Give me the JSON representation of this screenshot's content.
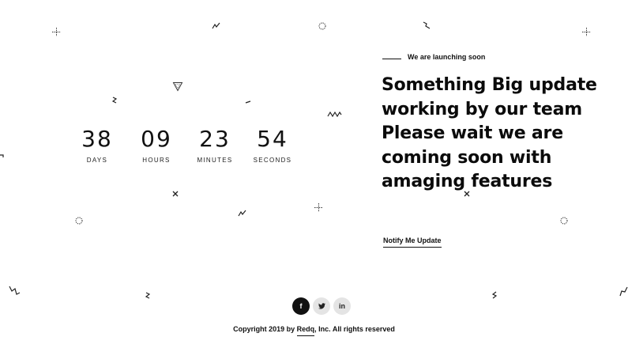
{
  "countdown": {
    "days": {
      "value": "38",
      "label": "DAYS"
    },
    "hours": {
      "value": "09",
      "label": "HOURS"
    },
    "minutes": {
      "value": "23",
      "label": "MINUTES"
    },
    "seconds": {
      "value": "54",
      "label": "SECONDS"
    }
  },
  "hero": {
    "tagline": "We are launching soon",
    "headline": "Something Big update working by our team Please wait we are coming soon with amaging features",
    "notify_label": "Notify Me Update"
  },
  "footer": {
    "social": [
      {
        "icon": "facebook-icon",
        "glyph": "f"
      },
      {
        "icon": "twitter-icon",
        "glyph": "t"
      },
      {
        "icon": "linkedin-icon",
        "glyph": "in"
      }
    ],
    "copyright_prefix": "Copyright 2019 by ",
    "company": "Redq",
    "copyright_suffix": ", Inc. All rights reserved"
  },
  "colors": {
    "background": "#ffffff",
    "text": "#111111",
    "social_dark": "#111111",
    "social_light": "#e4e4e4"
  }
}
